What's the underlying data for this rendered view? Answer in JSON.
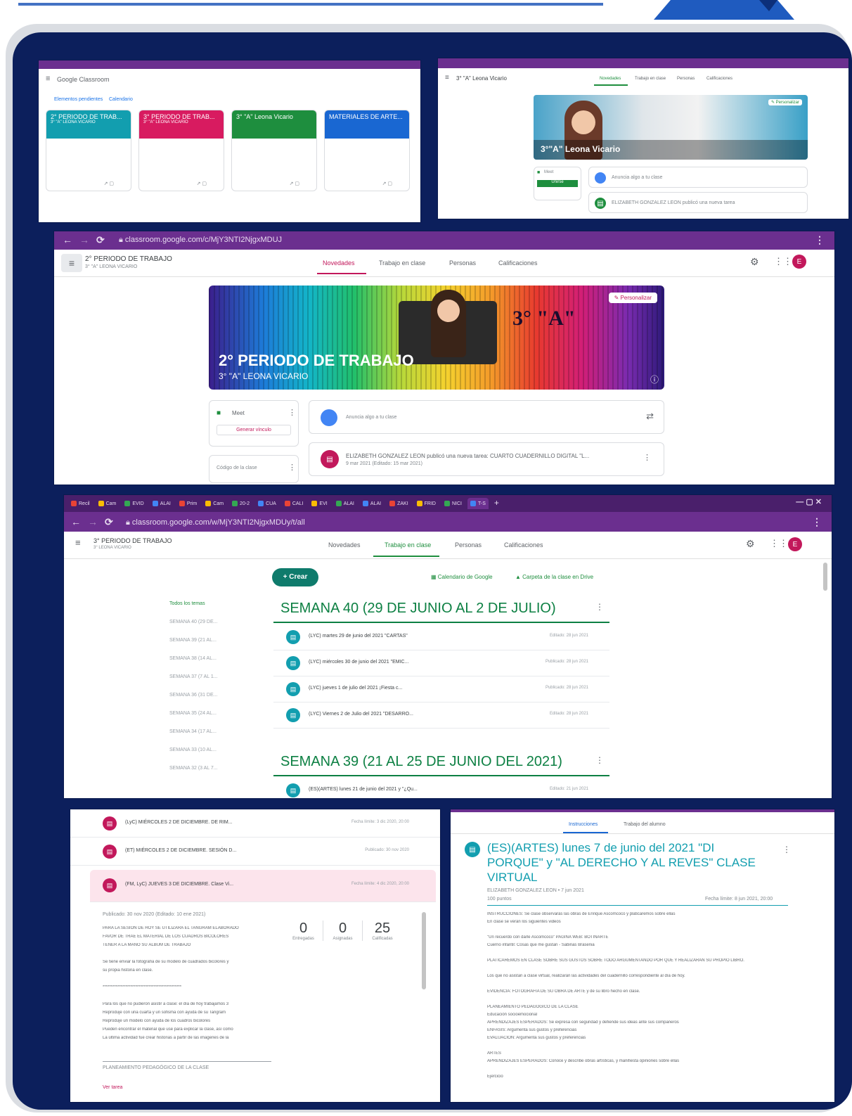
{
  "shot1": {
    "app_title": "Google Classroom",
    "links": [
      "Elementos pendientes",
      "Calendario"
    ],
    "cards": [
      {
        "title": "2° PERIODO DE TRAB...",
        "subtitle": "3° \"A\" LEONA VICARIO",
        "color": "#129eaf"
      },
      {
        "title": "3° PERIODO DE TRAB...",
        "subtitle": "3° \"A\" LEONA VICARIO",
        "color": "#d81b60"
      },
      {
        "title": "3° \"A\" Leona Vicario",
        "subtitle": "",
        "color": "#1e8e3e"
      },
      {
        "title": "MATERIALES DE ARTE...",
        "subtitle": "",
        "color": "#1967d2"
      }
    ]
  },
  "shot2": {
    "class_title": "3° \"A\" Leona Vicario",
    "tabs": [
      "Novedades",
      "Trabajo en clase",
      "Personas",
      "Calificaciones"
    ],
    "banner_title": "3°\"A\" Leona Vicario",
    "customize": "Personalizar",
    "meet": "Meet",
    "join": "Unirse",
    "announce_placeholder": "Anuncia algo a tu clase",
    "post": "ELIZABETH GONZALEZ LEON publicó una nueva tarea"
  },
  "shot3": {
    "url": "classroom.google.com/c/MjY3NTI2NjgxMDUJ",
    "class_title": "2° PERIODO DE TRABAJO",
    "class_subtitle": "3° \"A\" LEONA VICARIO",
    "tabs": [
      "Novedades",
      "Trabajo en clase",
      "Personas",
      "Calificaciones"
    ],
    "banner_title": "2° PERIODO DE TRABAJO",
    "banner_subtitle": "3° \"A\" LEONA VICARIO",
    "banner_grade": "3° \"A\"",
    "customize": "Personalizar",
    "meet": "Meet",
    "meet_link": "Generar vínculo",
    "class_code": "Código de la clase",
    "announce_placeholder": "Anuncia algo a tu clase",
    "post": "ELIZABETH GONZALEZ LEON publicó una nueva tarea: CUARTO CUADERNILLO DIGITAL \"L...",
    "post_date": "9 mar 2021 (Editado: 15 mar 2021)",
    "avatar": "E"
  },
  "shot4": {
    "browser_tabs": [
      "Recil",
      "Cam",
      "EVID",
      "ALAI",
      "Prim",
      "Cam",
      "20-2",
      "CUA",
      "CALI",
      "EVI",
      "ALAI",
      "ALAI",
      "ZAKI",
      "FRID",
      "NICI",
      "T-S"
    ],
    "url": "classroom.google.com/w/MjY3NTI2NjgxMDUy/t/all",
    "class_title": "3° PERIODO DE TRABAJO",
    "class_subtitle": "3° LEONA VICARIO",
    "tabs": [
      "Novedades",
      "Trabajo en clase",
      "Personas",
      "Calificaciones"
    ],
    "create": "+ Crear",
    "calendar_link": "Calendario de Google",
    "drive_link": "Carpeta de la clase en Drive",
    "sidebar": [
      "Todos los temas",
      "SEMANA 40 (29 DE...",
      "SEMANA 39 (21 AL...",
      "SEMANA 38 (14 AL...",
      "SEMANA 37 (7 AL 1...",
      "SEMANA 36 (31 DE...",
      "SEMANA 35 (24 AL...",
      "SEMANA 34 (17 AL...",
      "SEMANA 33 (10 AL...",
      "SEMANA 32 (3 AL 7..."
    ],
    "week40_title": "SEMANA 40 (29 DE JUNIO AL 2 DE JULIO)",
    "week40_rows": [
      {
        "text": "(LYC) martes 29 de junio del 2021 \"CARTAS\"",
        "date": "Editado: 28 jun 2021"
      },
      {
        "text": "(LYC) miércoles 30 de junio del 2021 \"EMIC...",
        "date": "Publicado: 28 jun 2021"
      },
      {
        "text": "(LYC) jueves 1 de julio del 2021 ¡Fiesta c...",
        "date": "Publicado: 28 jun 2021"
      },
      {
        "text": "(LYC) Viernes 2 de Julio del 2021 \"DESARRO...",
        "date": "Editado: 28 jun 2021"
      }
    ],
    "week39_title": "SEMANA 39 (21 AL 25 DE JUNIO DEL 2021)",
    "week39_rows": [
      {
        "text": "(ES)(ARTES) lunes 21 de junio del 2021 y \"¿Qu...",
        "date": "Editado: 21 jun 2021"
      }
    ],
    "avatar": "E"
  },
  "shot5": {
    "rows": [
      {
        "text": "(LyC) MIÉRCOLES 2 DE DICIEMBRE. DE RIM...",
        "date": "Fecha límite: 3 dic 2020, 20:00"
      },
      {
        "text": "(ET) MIÉRCOLES 2 DE DICIEMBRE. SESIÓN D...",
        "date": "Publicado: 30 nov 2020"
      },
      {
        "text": "(FM, LyC) JUEVES 3 DE DICIEMBRE. Clase Vi...",
        "date": "Fecha límite: 4 dic 2020, 20:00"
      }
    ],
    "posted": "Publicado: 30 nov 2020 (Editado: 10 ene 2021)",
    "body": [
      "PARA LA SESION DE HOY SE UTILIZARA EL TANGRAM ELABORADO",
      "FAVOR DE TRAE EL MATERIAL DE LOS CUADROS BICOLORES",
      "TENER A LA MANO SU ÁLBUM DE TRABAJO",
      "",
      "Se tiene enviar la fotografía de su modelo de cuadrados bicolores y",
      "su propia historia en clase.",
      "",
      "************************************************",
      "",
      "Para los que no pudieron asistir a clase: el día de hoy trabajamos 3",
      "Reproduje con una cuarta y un sofisma con ayuda de su Tangram",
      "Reproduje un modelo con ayuda de los cuadros bicolores",
      "Pueden encontrar el material que use para explicar la clase, así como",
      "La última actividad fue crear historias a partir de las imagenes de la"
    ],
    "stats": [
      {
        "value": "0",
        "label": "Entregadas"
      },
      {
        "value": "0",
        "label": "Asignadas"
      },
      {
        "value": "25",
        "label": "Calificadas"
      }
    ],
    "footer": "PLANEAMIENTO PEDAGÓGICO DE LA CLASE",
    "view_task": "Ver tarea"
  },
  "shot6": {
    "tabs": [
      "Instrucciones",
      "Trabajo del alumno"
    ],
    "title": "(ES)(ARTES) lunes 7 de junio del 2021 \"DI PORQUE\" y \"AL DERECHO Y AL REVES\" CLASE VIRTUAL",
    "author": "ELIZABETH GONZALEZ LEON • 7 jun 2021",
    "points": "100 puntos",
    "due": "Fecha límite: 8 jun 2021, 20:00",
    "lines": [
      "INSTRUCCIONES: Se clase observarás las obras de Enrique Ascomcoco y platicaremos sobre ellas",
      "En clase se verán los siguientes videos",
      "",
      "\"Un recuerdo con darle Ascomcoco\" PAGINA WEB: BOTINARTE",
      "Cuerno infantil: Cosas que me gustan - Sabinas Brasenia",
      "",
      "PLATICAREMOS EN CLASE SOBRE SUS GUSTOS SOBRE TODO ARGUMENTANDO POR QUE Y REALIZARÁN SU PROPIO LIBRO.",
      "",
      "Los que no asistan a clase virtual, realizarán las actividades del cuadernillo correspondiente al día de hoy.",
      "",
      "EVIDENCIA: FOTOGRAFÍA DE SU OBRA DE ARTE y de su libro hecho en clase.",
      "",
      "PLANEAMIENTO PEDAGÓGICO DE LA CLASE",
      "Educación socioemocional",
      "APRENDIZAJES ESPERADOS: Se expresa con seguridad y defiende sus ideas ante sus compañeros",
      "ÉNFASIS: Argumenta sus gustos y preferencias",
      "EVALUACIÓN: Argumenta sus gustos y preferencias",
      "",
      "ARTES",
      "APRENDIZAJES ESPERADOS: Conoce y describe obras artísticas, y manifiesta opiniones sobre ellas",
      "",
      "Ejercicio"
    ]
  },
  "colors": {
    "navy": "#0c1f5c",
    "purple_bar": "#6b2f8f",
    "green": "#0d8043",
    "pink": "#c2185b",
    "teal": "#129eaf"
  }
}
